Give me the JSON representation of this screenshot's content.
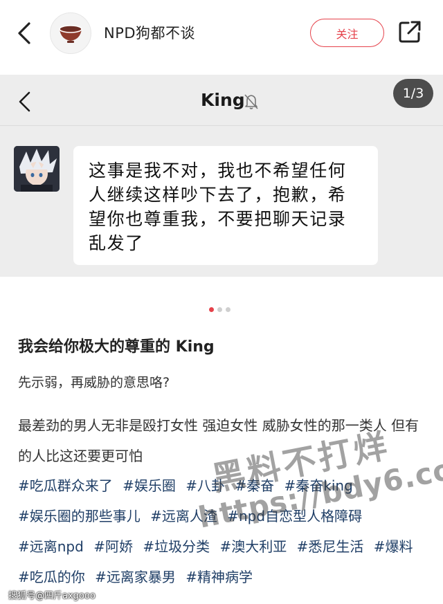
{
  "header": {
    "author_name": "NPD狗都不谈",
    "follow_label": "关注",
    "icons": {
      "back": "chevron-left-icon",
      "avatar": "bowl-icon",
      "share": "share-out-icon"
    }
  },
  "chat_screenshot": {
    "title": "King",
    "page_indicator": "1/3",
    "message": "这事是我不对，我也不希望任何人继续这样吵下去了，抱歉，希望你也尊重我，不要把聊天记录乱发了",
    "icons": {
      "back": "chevron-left-icon",
      "mute": "bell-muted-icon"
    }
  },
  "carousel": {
    "count": 3,
    "active_index": 0
  },
  "post": {
    "title": "我会给你极大的尊重的 King",
    "line1": "先示弱，再威胁的意思咯?",
    "paragraph": "最差劲的男人无非是殴打女性 强迫女性 威胁女性的那一类人 但有的人比这还要更可怕",
    "tags": [
      "#吃瓜群众来了",
      "#娱乐圈",
      "#八卦",
      "#秦奋",
      "#秦奋king",
      "#娱乐圈的那些事儿",
      "#远离人渣",
      "#npd自恋型人格障碍",
      "#远离npd",
      "#阿娇",
      "#垃圾分类",
      "#澳大利亚",
      "#悉尼生活",
      "#爆料",
      "#吃瓜的你",
      "#远离家暴男",
      "#精神病学"
    ]
  },
  "watermark": {
    "line1": "黑料不打烊",
    "line2": "https://bdy6.co"
  },
  "footer_watermark": "搜狐号@四斤axgooo",
  "colors": {
    "accent": "#e5414a",
    "tag": "#1f3e66",
    "chat_bg": "#ededed"
  }
}
